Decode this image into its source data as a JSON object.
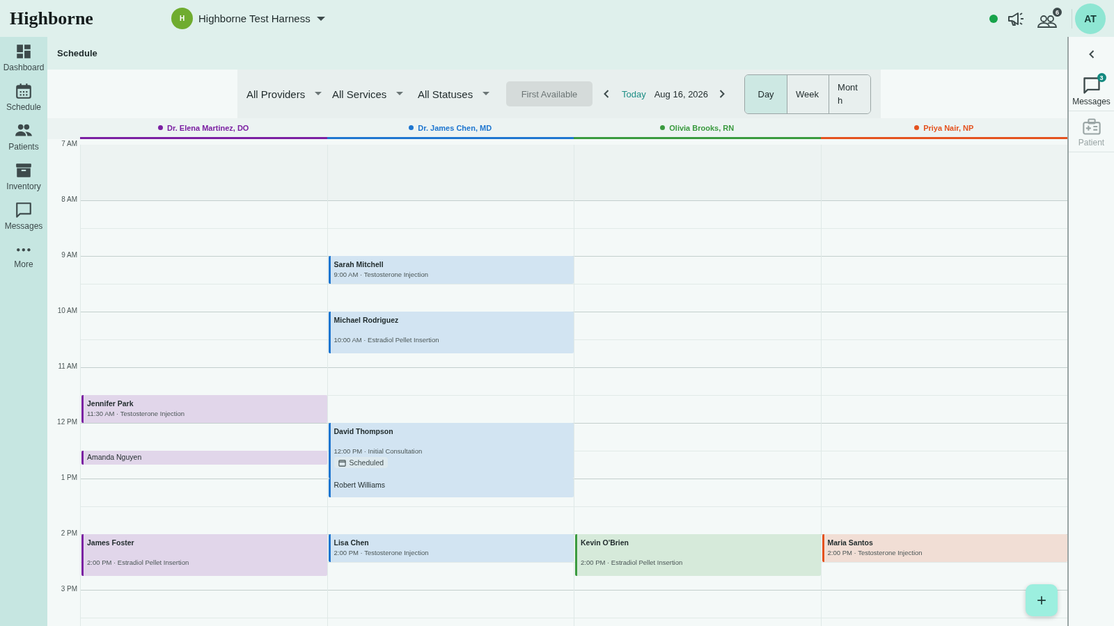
{
  "app": {
    "logo": "Highborne"
  },
  "organization": {
    "initial": "H",
    "name": "Highborne Test Harness"
  },
  "status": {
    "online": true
  },
  "team": {
    "badge": "6"
  },
  "user": {
    "initials": "AT"
  },
  "nav": [
    {
      "label": "Dashboard",
      "kind": "dashboard"
    },
    {
      "label": "Schedule",
      "kind": "schedule"
    },
    {
      "label": "Patients",
      "kind": "patients"
    },
    {
      "label": "Inventory",
      "kind": "inventory"
    },
    {
      "label": "Messages",
      "kind": "messages"
    },
    {
      "label": "More",
      "kind": "more"
    }
  ],
  "page_title": "Schedule",
  "filters": [
    {
      "label": "All Providers"
    },
    {
      "label": "All Services"
    },
    {
      "label": "All Statuses"
    }
  ],
  "first_available": {
    "label": "First Available",
    "disabled": true
  },
  "date_nav": {
    "today": "Today",
    "date": "Aug 16, 2026"
  },
  "views": [
    {
      "label": "Day",
      "selected": true
    },
    {
      "label": "Week",
      "selected": false
    },
    {
      "label": "Month",
      "selected": false
    }
  ],
  "hours": [
    "7 AM",
    "8 AM",
    "9 AM",
    "10 AM",
    "11 AM",
    "12 PM",
    "1 PM",
    "2 PM",
    "3 PM"
  ],
  "providers": [
    {
      "name": "Dr. Elena Martinez, DO",
      "color": "#7b1fa2",
      "appointments": [
        {
          "patient": "Jennifer Park",
          "details": "11:30 AM · Testosterone Injection",
          "kind": "half"
        },
        {
          "patient": "Amanda Nguyen",
          "follows": true,
          "gap": true,
          "kind": "quarter"
        },
        {
          "patient": "James Foster",
          "details": "2:00 PM · Estradiol Pellet Insertion",
          "kind": "long"
        }
      ]
    },
    {
      "name": "Dr. James Chen, MD",
      "color": "#1e76d0",
      "appointments": [
        {
          "patient": "Sarah Mitchell",
          "details": "9:00 AM · Testosterone Injection",
          "kind": "half"
        },
        {
          "patient": "Michael Rodriguez",
          "details": "10:00 AM · Estradiol Pellet Insertion",
          "kind": "long"
        },
        {
          "patient": "David Thompson",
          "details": "12:00 PM · Initial Consultation",
          "status": "Scheduled",
          "kind": "hour"
        },
        {
          "patient": "Robert Williams",
          "follows": true,
          "gap": false,
          "kind": "third"
        },
        {
          "patient": "Lisa Chen",
          "details": "2:00 PM · Testosterone Injection",
          "kind": "half"
        }
      ]
    },
    {
      "name": "Olivia Brooks, RN",
      "color": "#3a9a3f",
      "appointments": [
        {
          "patient": "Kevin O'Brien",
          "details": "2:00 PM · Estradiol Pellet Insertion",
          "kind": "long"
        }
      ]
    },
    {
      "name": "Priya Nair, NP",
      "color": "#e4521f",
      "appointments": [
        {
          "patient": "Maria Santos",
          "details": "2:00 PM · Testosterone Injection",
          "kind": "half"
        }
      ]
    }
  ],
  "side_panel": {
    "items": [
      {
        "label": "Messages",
        "kind": "messages",
        "badge": "3",
        "disabled": false
      },
      {
        "label": "Patient",
        "kind": "patient",
        "disabled": true
      }
    ]
  },
  "fab": {
    "label": "+"
  }
}
